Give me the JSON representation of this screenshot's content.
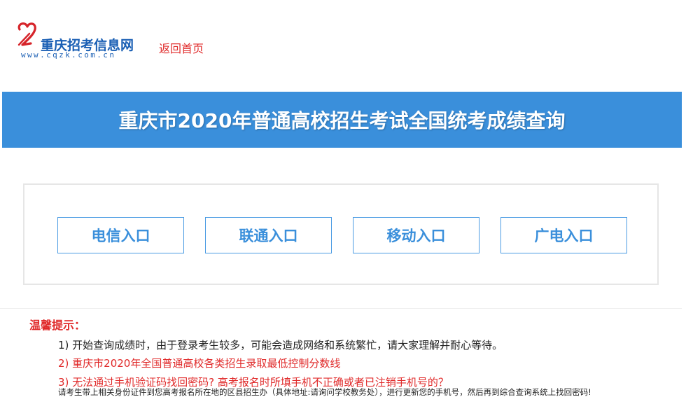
{
  "header": {
    "logo_name": "重庆招考信息网",
    "logo_url": "www.cqzk.com.cn",
    "back_link": "返回首页"
  },
  "banner": {
    "title": "重庆市2020年普通高校招生考试全国统考成绩查询",
    "color": "#3a8fdb"
  },
  "entries": [
    {
      "label": "电信入口"
    },
    {
      "label": "联通入口"
    },
    {
      "label": "移动入口"
    },
    {
      "label": "广电入口"
    }
  ],
  "tips": {
    "title": "温馨提示：",
    "items": [
      "1) 开始查询成绩时，由于登录考生较多，可能会造成网络和系统繁忙，请大家理解并耐心等待。",
      "2) 重庆市2020年全国普通高校各类招生录取最低控制分数线",
      "3) 无法通过手机验证码找回密码? 高考报名时所填手机不正确或者已注销手机号的？"
    ],
    "note": "请考生带上相关身份证件到您高考报名所在地的区县招生办（具体地址:请询问学校教务处），进行更新您的手机号，然后再到综合查询系统上找回密码!"
  },
  "colors": {
    "accent": "#3a8fdb",
    "warning": "#e02a2a"
  }
}
